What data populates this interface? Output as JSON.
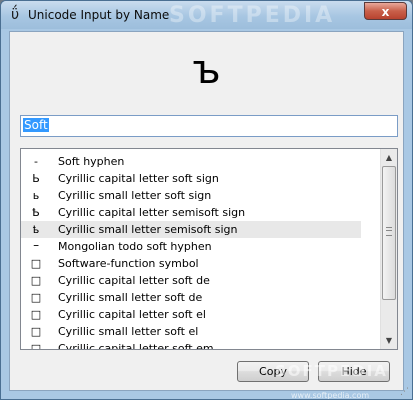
{
  "window": {
    "title": "Unicode Input by Name",
    "title_watermark": "SOFTPEDIA",
    "close_label": "x"
  },
  "preview": {
    "character": "ъ"
  },
  "search": {
    "value": "Soft"
  },
  "results": [
    {
      "glyph": "-",
      "name": "Soft hyphen"
    },
    {
      "glyph": "Ь",
      "name": "Cyrillic capital letter soft sign"
    },
    {
      "glyph": "ь",
      "name": "Cyrillic small letter soft sign"
    },
    {
      "glyph": "Ҍ",
      "name": "Cyrillic capital letter semisoft sign"
    },
    {
      "glyph": "ҍ",
      "name": "Cyrillic small letter semisoft sign"
    },
    {
      "glyph": "᠆",
      "name": "Mongolian todo soft hyphen"
    },
    {
      "glyph": "□",
      "name": "Software-function symbol"
    },
    {
      "glyph": "□",
      "name": "Cyrillic capital letter soft de"
    },
    {
      "glyph": "□",
      "name": "Cyrillic small letter soft de"
    },
    {
      "glyph": "□",
      "name": "Cyrillic capital letter soft el"
    },
    {
      "glyph": "□",
      "name": "Cyrillic small letter soft el"
    },
    {
      "glyph": "□",
      "name": "Cyrillic capital letter soft em"
    }
  ],
  "highlighted_index": 4,
  "buttons": {
    "copy_label": "Copy",
    "hide_label": "Hide"
  },
  "footer_watermark": "SOFTPEDIA",
  "footer_url": "www.softpedia.com",
  "icons": {
    "app": "unicode-u-icon",
    "scroll_up": "triangle-up",
    "scroll_down": "triangle-down"
  },
  "colors": {
    "selection": "#3399ff",
    "title_bar": "#a7c6e2",
    "close_button": "#c9604a"
  }
}
